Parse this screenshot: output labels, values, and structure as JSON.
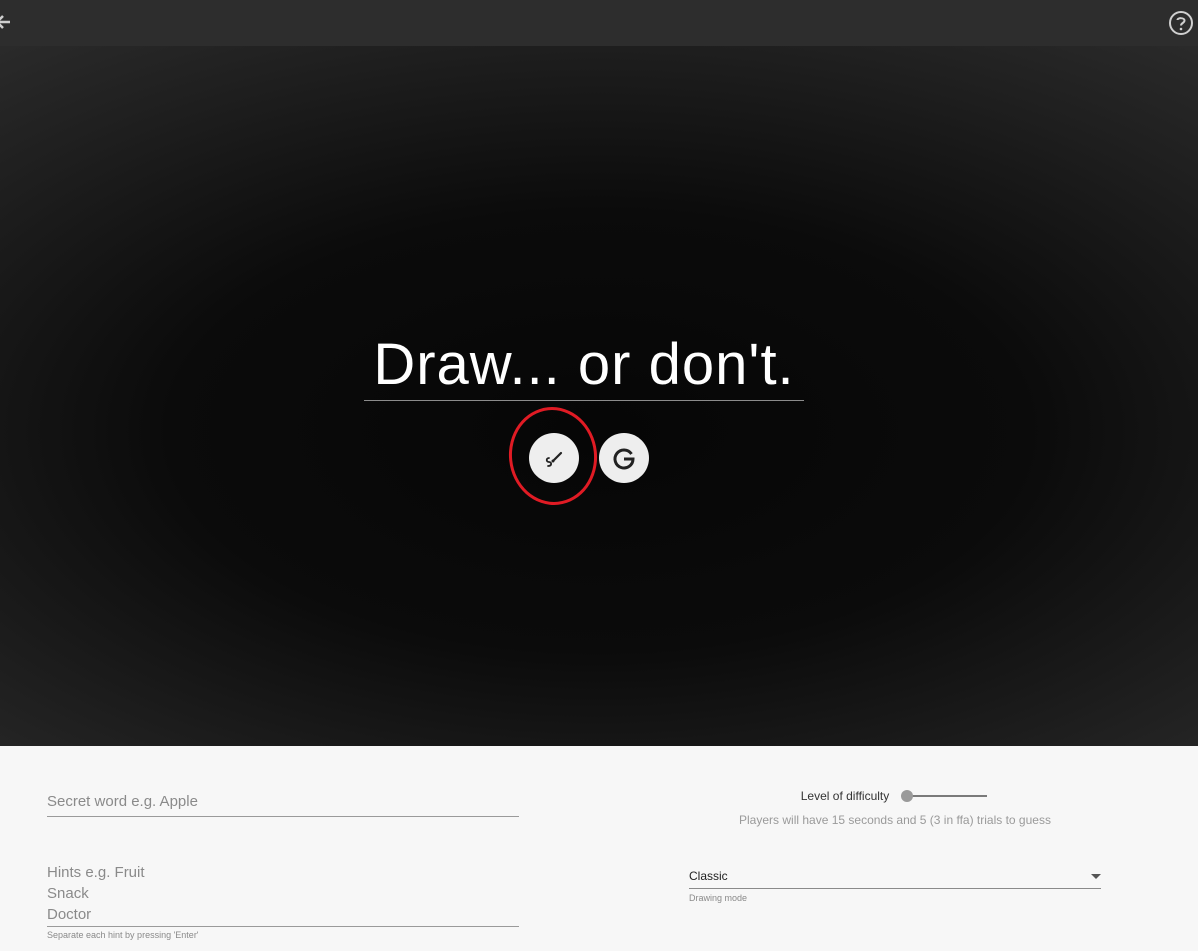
{
  "topbar": {
    "back_icon": "arrow-left-icon",
    "help_icon": "help-circle-icon"
  },
  "hero": {
    "headline": "Draw... or don't.",
    "draw_button_icon": "brush-icon",
    "google_button_icon": "google-g-icon",
    "annotation_color": "#e01b24"
  },
  "form": {
    "secret_placeholder": "Secret word e.g. Apple",
    "hints_lines": [
      "Hints e.g. Fruit",
      "Snack",
      "Doctor"
    ],
    "hints_helper": "Separate each hint by pressing 'Enter'",
    "difficulty_label": "Level of difficulty",
    "difficulty_desc": "Players will have 15 seconds and 5 (3 in ffa) trials to guess",
    "mode_value": "Classic",
    "mode_label": "Drawing mode"
  }
}
